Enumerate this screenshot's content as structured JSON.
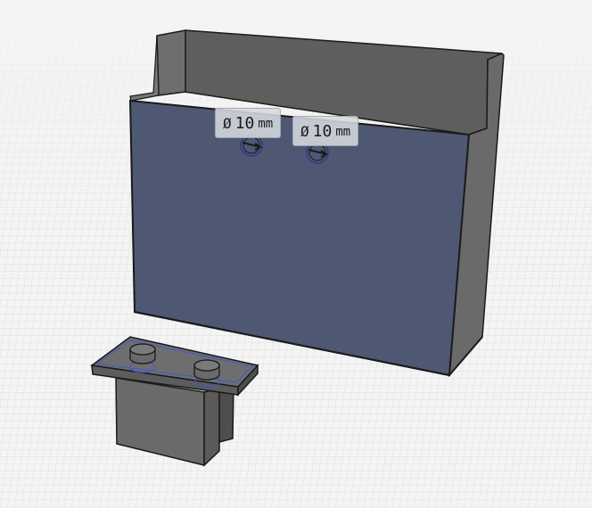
{
  "colors": {
    "background": "#f4f4f4",
    "grid_line": "#d4d4d4",
    "selected_face": "#4e5873",
    "box_body": "#6a6a6a",
    "box_inner": "#585858",
    "edge": "#1a1a1a",
    "selection_edge": "#3a55d8",
    "label_fill": "#d6d8de"
  },
  "dimensions": [
    {
      "symbol": "Ø",
      "value": "10",
      "unit": "mm"
    },
    {
      "symbol": "Ø",
      "value": "10",
      "unit": "mm"
    }
  ]
}
